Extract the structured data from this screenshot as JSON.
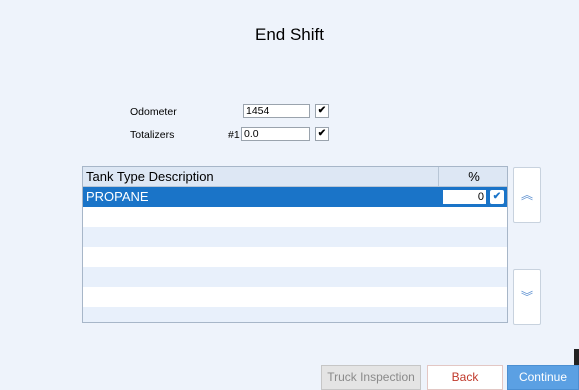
{
  "page": {
    "title": "End Shift"
  },
  "form": {
    "odometer_label": "Odometer",
    "odometer_value": "1454",
    "totalizers_label": "Totalizers",
    "totalizer_index": "#1",
    "totalizer_value": "0.0",
    "check_mark": "✔"
  },
  "table": {
    "headers": {
      "description": "Tank Type Description",
      "percent": "%"
    },
    "rows": [
      {
        "description": "PROPANE",
        "percent": "0",
        "selected": true
      }
    ]
  },
  "scroll": {
    "up_icon": "double-chevron-up-icon",
    "down_icon": "double-chevron-down-icon",
    "up_glyph": "︽",
    "down_glyph": "︾"
  },
  "buttons": {
    "truck_inspection": "Truck Inspection",
    "back": "Back",
    "continue": "Continue"
  },
  "colors": {
    "selection": "#1a74c8",
    "back_text": "#c0392b",
    "continue_bg": "#5ba0e3"
  }
}
